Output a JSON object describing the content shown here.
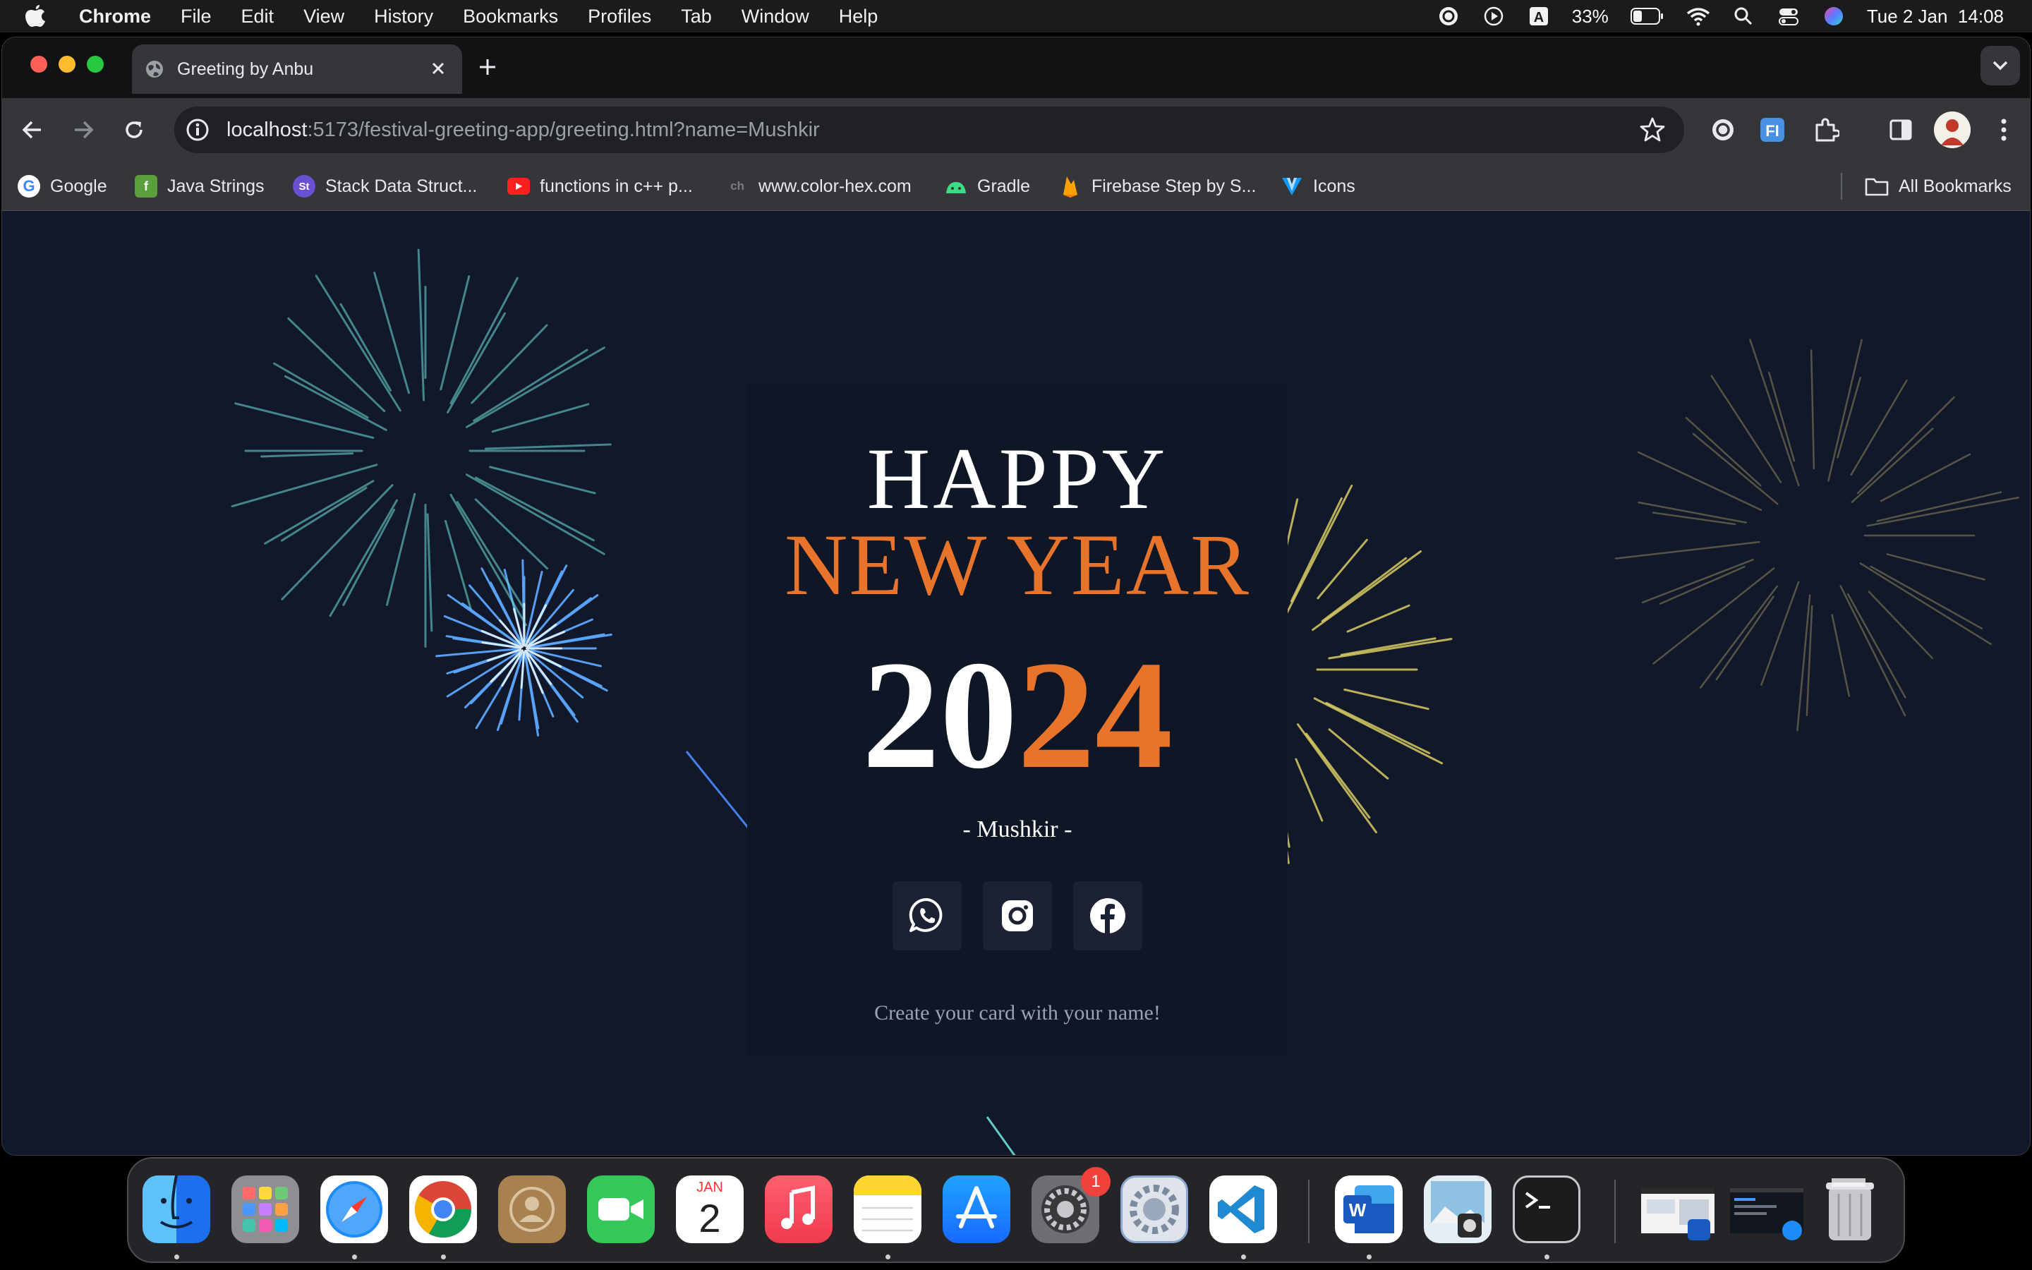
{
  "menubar": {
    "app": "Chrome",
    "items": [
      "File",
      "Edit",
      "View",
      "History",
      "Bookmarks",
      "Profiles",
      "Tab",
      "Window",
      "Help"
    ],
    "battery": "33%",
    "datetime": "Tue 2 Jan  14:08"
  },
  "browser": {
    "tab_title": "Greeting by Anbu",
    "url_host": "localhost",
    "url_rest": ":5173/festival-greeting-app/greeting.html?name=Mushkir",
    "bookmarks": [
      {
        "label": "Google",
        "icon": "google-icon"
      },
      {
        "label": "Java Strings",
        "icon": "java-icon"
      },
      {
        "label": "Stack Data Struct...",
        "icon": "st-icon"
      },
      {
        "label": "functions in c++ p...",
        "icon": "youtube-icon"
      },
      {
        "label": "www.color-hex.com",
        "icon": "color-hex-icon"
      },
      {
        "label": "Gradle",
        "icon": "gradle-icon"
      },
      {
        "label": "Firebase Step by S...",
        "icon": "firebase-icon"
      },
      {
        "label": "Icons",
        "icon": "vuetify-icon"
      }
    ],
    "all_bookmarks": "All Bookmarks"
  },
  "card": {
    "line1": "HAPPY",
    "line2": "NEW YEAR",
    "year_part1": "20",
    "year_part2": "24",
    "signature": "- Mushkir -",
    "cta": "Create your card with your name!",
    "socials": [
      "whatsapp-icon",
      "instagram-icon",
      "facebook-icon"
    ]
  },
  "dock": {
    "calendar_month": "JAN",
    "calendar_day": "2",
    "settings_badge": "1",
    "apps": [
      "Finder",
      "Launchpad",
      "Safari",
      "Chrome",
      "Contacts",
      "FaceTime",
      "Calendar",
      "Music",
      "Notes",
      "App Store",
      "System Settings",
      "System Preferences",
      "VS Code",
      "Word",
      "Preview",
      "Terminal",
      "Screenshot 1",
      "Screenshot 2",
      "Trash"
    ]
  },
  "colors": {
    "accent_orange": "#e8742c",
    "page_bg": "#111829",
    "card_bg": "#0f1626"
  }
}
